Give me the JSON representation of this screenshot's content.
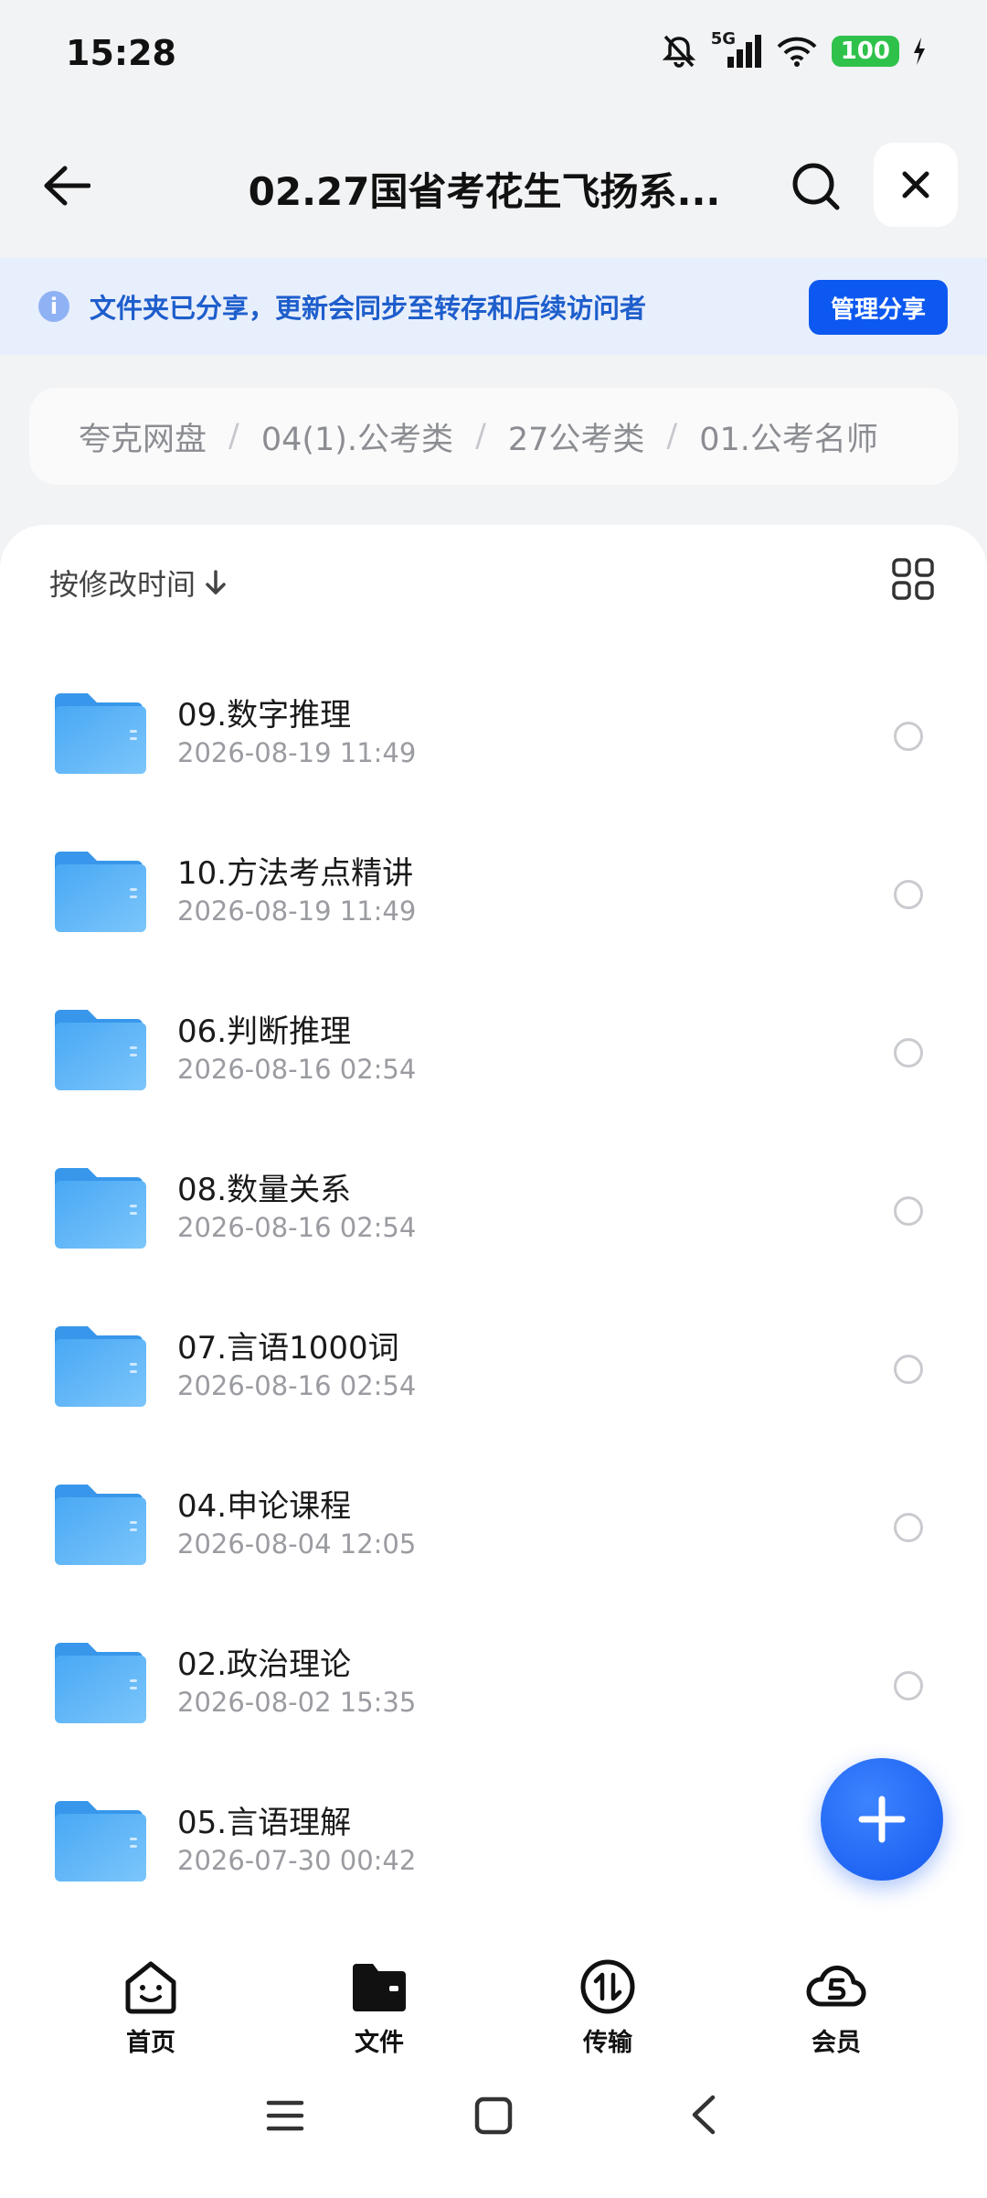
{
  "status_bar": {
    "time": "15:28",
    "network": "5G",
    "battery": "100",
    "icons": [
      "mute-icon",
      "signal-icon",
      "wifi-icon",
      "battery-icon",
      "charging-icon"
    ]
  },
  "header": {
    "title": "02.27国省考花生飞扬系...",
    "icons": [
      "back-arrow-icon",
      "search-icon",
      "close-icon"
    ]
  },
  "banner": {
    "text": "文件夹已分享，更新会同步至转存和后续访问者",
    "button": "管理分享",
    "icon": "info-icon"
  },
  "breadcrumb": [
    "夸克网盘",
    "04(1).公考类",
    "27公考类",
    "01.公考名师"
  ],
  "breadcrumb_separator": "/",
  "sort": {
    "label": "按修改时间",
    "icon": "arrow-down-icon"
  },
  "view_toggle_icon": "grid-view-icon",
  "files": [
    {
      "name": "09.数字推理",
      "date": "2026-08-19 11:49"
    },
    {
      "name": "10.方法考点精讲",
      "date": "2026-08-19 11:49"
    },
    {
      "name": "06.判断推理",
      "date": "2026-08-16 02:54"
    },
    {
      "name": "08.数量关系",
      "date": "2026-08-16 02:54"
    },
    {
      "name": "07.言语1000词",
      "date": "2026-08-16 02:54"
    },
    {
      "name": "04.申论课程",
      "date": "2026-08-04 12:05"
    },
    {
      "name": "02.政治理论",
      "date": "2026-08-02 15:35"
    },
    {
      "name": "05.言语理解",
      "date": "2026-07-30 00:42"
    }
  ],
  "fab_icon": "plus-icon",
  "bottom_nav": [
    {
      "label": "首页",
      "icon": "smile-home-icon"
    },
    {
      "label": "文件",
      "icon": "folder-icon"
    },
    {
      "label": "传输",
      "icon": "transfer-icon"
    },
    {
      "label": "会员",
      "icon": "cloud-vip-icon"
    }
  ],
  "system_nav_icons": [
    "menu-icon",
    "home-square-icon",
    "back-chevron-icon"
  ],
  "colors": {
    "accent": "#0d58f0",
    "banner_bg": "#e8effc",
    "banner_text": "#1e5ecc",
    "folder": "#5ab0f5",
    "battery": "#2fc24b"
  }
}
